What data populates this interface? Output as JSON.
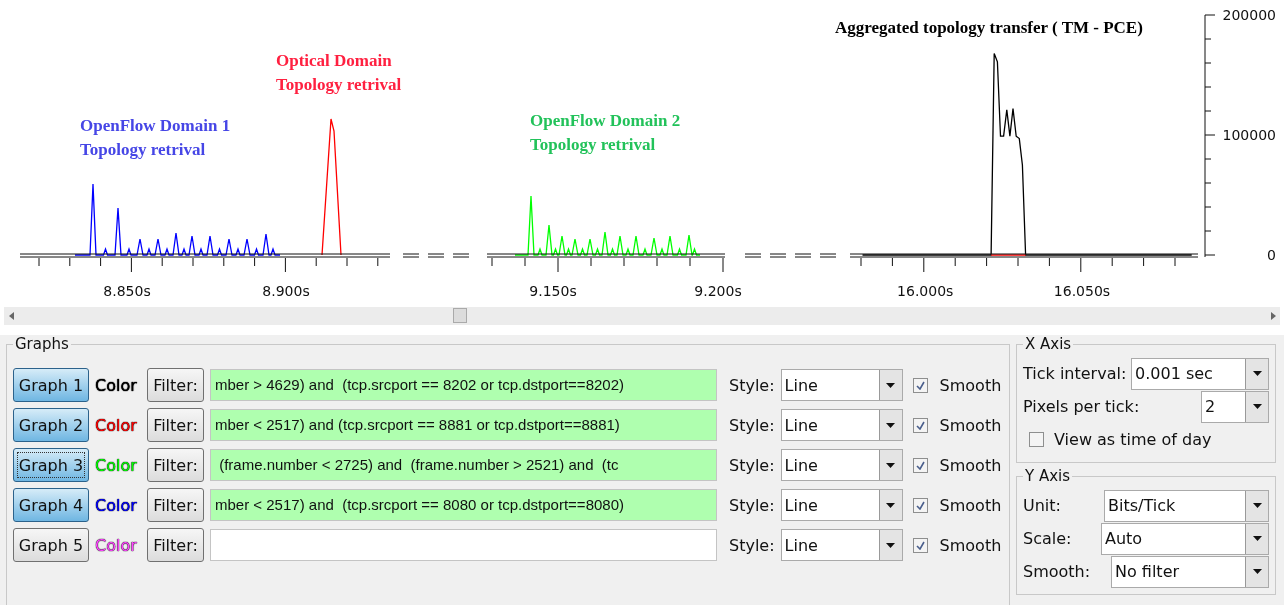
{
  "plot": {
    "annotations": [
      {
        "lines": [
          "OpenFlow Domain 1",
          "Topology retrival"
        ],
        "color": "#4646e6"
      },
      {
        "lines": [
          "Optical Domain",
          "Topology retrival"
        ],
        "color": "#ff2040"
      },
      {
        "lines": [
          "OpenFlow Domain 2",
          "Topology retrival"
        ],
        "color": "#22c25a"
      },
      {
        "lines": [
          "Aggregated topology transfer ( TM - PCE)"
        ],
        "color": "#000000"
      }
    ],
    "x_tick_labels": [
      "8.850s",
      "8.900s",
      "9.150s",
      "9.200s"
    ],
    "chart_data": {
      "type": "line",
      "x": [
        15.98,
        16.021,
        16.022,
        16.023,
        16.024,
        16.025,
        16.026,
        16.027,
        16.028,
        16.029,
        16.03,
        16.031,
        16.032,
        16.085
      ],
      "series": [
        {
          "color": "#000000",
          "values": [
            0,
            0,
            168000,
            161000,
            99000,
            99000,
            121000,
            99000,
            122000,
            99000,
            97000,
            75000,
            0,
            0
          ]
        },
        {
          "color": "#ff0000",
          "values": [
            null,
            0,
            0,
            0,
            0,
            0,
            0,
            0,
            0,
            0,
            0,
            0,
            0,
            null
          ]
        }
      ],
      "xticks": [
        {
          "value": 16.0,
          "label": "16.000s"
        },
        {
          "value": 16.05,
          "label": "16.050s"
        }
      ],
      "xlim": [
        15.976,
        16.087
      ],
      "ylim": [
        0,
        200000
      ],
      "yticks": [
        {
          "value": 0,
          "label": "0"
        },
        {
          "value": 100000,
          "label": "100000"
        },
        {
          "value": 200000,
          "label": "200000"
        }
      ]
    }
  },
  "graphs_panel": {
    "title": "Graphs",
    "graphs": [
      {
        "label": "Graph 1",
        "selected": true,
        "focused": false,
        "color_label": "Color",
        "color": "#000000",
        "filter_label": "Filter:",
        "filter": "mber > 4629) and  (tcp.srcport == 8202 or tcp.dstport==8202)",
        "style_label": "Style:",
        "style": "Line",
        "smooth_label": "Smooth",
        "smooth": true
      },
      {
        "label": "Graph 2",
        "selected": true,
        "focused": false,
        "color_label": "Color",
        "color": "#ff0000",
        "filter_label": "Filter:",
        "filter": "mber < 2517) and (tcp.srcport == 8881 or tcp.dstport==8881)",
        "style_label": "Style:",
        "style": "Line",
        "smooth_label": "Smooth",
        "smooth": true
      },
      {
        "label": "Graph 3",
        "selected": true,
        "focused": true,
        "color_label": "Color",
        "color": "#00ff00",
        "filter_label": "Filter:",
        "filter": " (frame.number < 2725) and  (frame.number > 2521) and  (tc",
        "style_label": "Style:",
        "style": "Line",
        "smooth_label": "Smooth",
        "smooth": true
      },
      {
        "label": "Graph 4",
        "selected": true,
        "focused": false,
        "color_label": "Color",
        "color": "#0000ff",
        "filter_label": "Filter:",
        "filter": "mber < 2517) and  (tcp.srcport == 8080 or tcp.dstport==8080)",
        "style_label": "Style:",
        "style": "Line",
        "smooth_label": "Smooth",
        "smooth": true
      },
      {
        "label": "Graph 5",
        "selected": false,
        "focused": false,
        "color_label": "Color",
        "color": "#ff44ff",
        "filter_label": "Filter:",
        "style_label": "Style:",
        "style": "Line",
        "smooth_label": "Smooth",
        "smooth": true
      }
    ]
  },
  "x_axis": {
    "title": "X Axis",
    "tick_interval_label": "Tick interval:",
    "tick_interval": "0.001 sec",
    "pixels_per_tick_label": "Pixels per tick:",
    "pixels_per_tick": "2",
    "time_of_day_label": "View as time of day",
    "time_of_day": false
  },
  "y_axis": {
    "title": "Y Axis",
    "unit_label": "Unit:",
    "unit": "Bits/Tick",
    "scale_label": "Scale:",
    "scale": "Auto",
    "smooth_label": "Smooth:",
    "smooth": "No filter"
  }
}
